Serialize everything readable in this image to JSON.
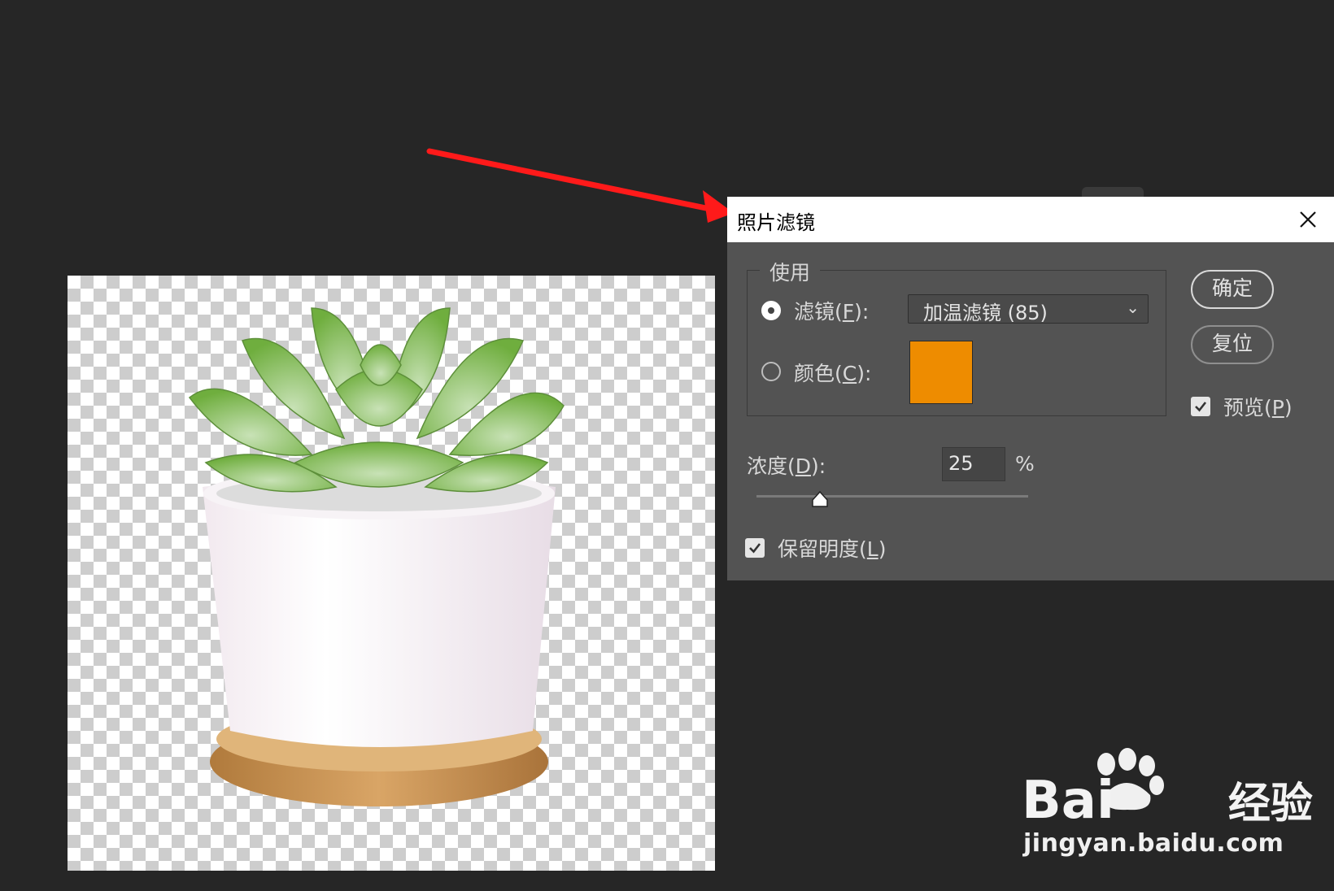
{
  "dialog": {
    "title": "照片滤镜",
    "use_group_label": "使用",
    "filter_option": {
      "text": "滤镜(",
      "key": "F",
      "end": "):",
      "selected": true
    },
    "color_option": {
      "text": "颜色(",
      "key": "C",
      "end": "):",
      "selected": false
    },
    "filter_select": {
      "value": "加温滤镜 (85)"
    },
    "color_swatch": "#ee8c00",
    "ok_button": "确定",
    "reset_button": "复位",
    "preview": {
      "text": "预览(",
      "key": "P",
      "end": ")",
      "checked": true
    },
    "density": {
      "text": "浓度(",
      "key": "D",
      "end": "):",
      "value": "25",
      "unit": "%",
      "slider_fraction": 0.25
    },
    "preserve_luminosity": {
      "text": "保留明度(",
      "key": "L",
      "end": ")",
      "checked": true
    }
  },
  "watermark": {
    "brand": "Bai",
    "suffix": "经验",
    "url": "jingyan.baidu.com"
  },
  "colors": {
    "annotation_arrow": "#ff1a1a",
    "app_bg": "#262626",
    "dialog_bg": "#535353"
  }
}
